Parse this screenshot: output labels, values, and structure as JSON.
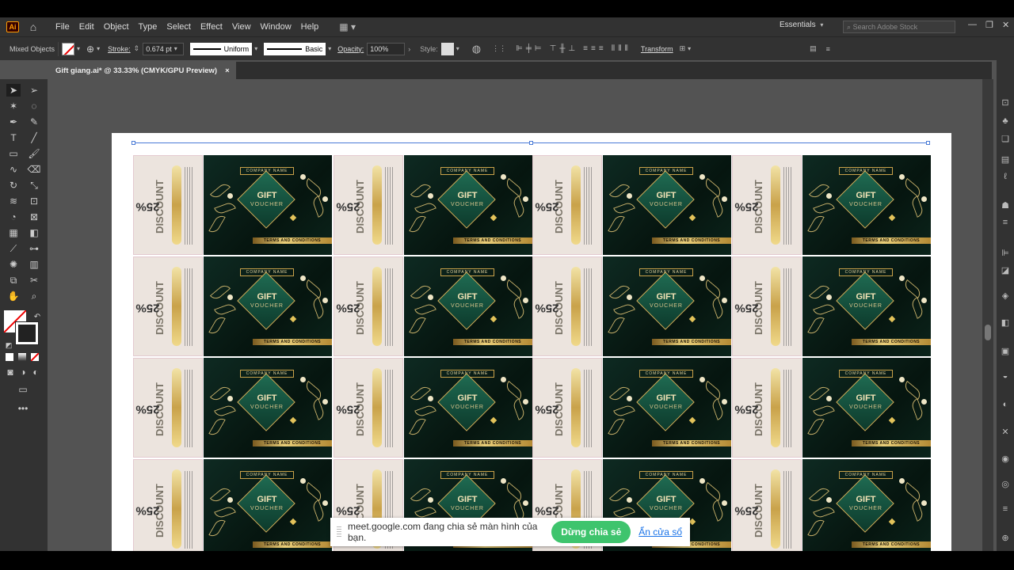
{
  "menubar": {
    "app_icon": "Ai",
    "items": [
      "File",
      "Edit",
      "Object",
      "Type",
      "Select",
      "Effect",
      "View",
      "Window",
      "Help"
    ],
    "workspace": "Essentials",
    "search_placeholder": "Search Adobe Stock"
  },
  "controlbar": {
    "selection_label": "Mixed Objects",
    "stroke_label": "Stroke:",
    "stroke_value": "0.674 pt",
    "profile_label": "Uniform",
    "brush_label": "Basic",
    "opacity_label": "Opacity:",
    "opacity_value": "100%",
    "style_label": "Style:",
    "transform_label": "Transform"
  },
  "document_tab": {
    "title": "Gift giang.ai* @ 33.33% (CMYK/GPU Preview)",
    "close": "×"
  },
  "voucher": {
    "discount_percent": "25%",
    "discount_word": "DISCOUNT",
    "terms_vertical": "TERMS AND CONDITIONS",
    "company": "COMPANY NAME",
    "gift": "GIFT",
    "voucher": "VOUCHER",
    "ribbon": "TERMS AND CONDITIONS"
  },
  "share_bar": {
    "message": "meet.google.com đang chia sẻ màn hình của bạn.",
    "stop_button": "Dừng chia sẻ",
    "hide_link": "Ẩn cửa sổ"
  },
  "colors": {
    "canvas": "#535353",
    "chrome": "#323232",
    "voucher_green": "#0e2a22",
    "gold": "#c9a24a",
    "stop_green": "#3ec46d"
  }
}
